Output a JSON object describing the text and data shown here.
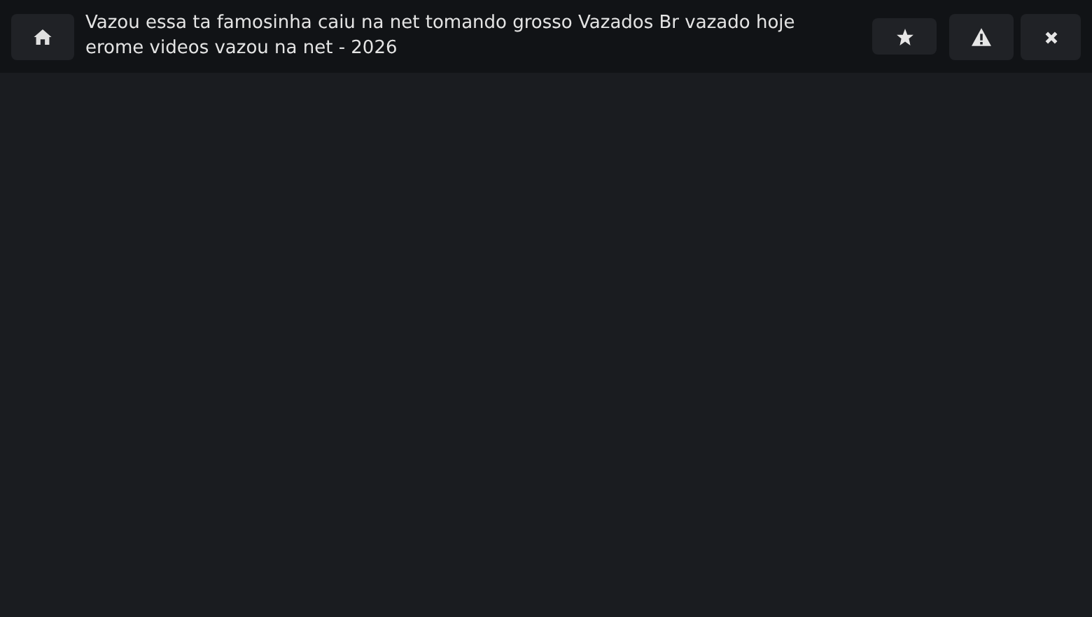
{
  "header": {
    "title": "Vazou essa ta famosinha caiu na net tomando grosso Vazados Br vazado hoje erome videos vazou na net - 2026"
  }
}
